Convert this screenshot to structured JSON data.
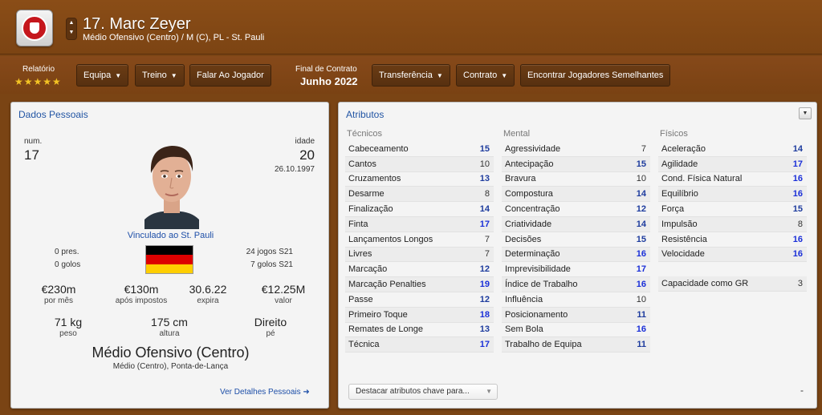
{
  "header": {
    "name": "17. Marc Zeyer",
    "subtitle": "Médio Ofensivo (Centro) / M (C), PL - St. Pauli",
    "arrow_up": "▲",
    "arrow_down": "▼"
  },
  "toolbar": {
    "rating_label": "Relatório",
    "rating_stars": "★★★★★",
    "rating_value": 5,
    "squad_btn": "Equipa",
    "training_btn": "Treino",
    "talk_btn": "Falar Ao Jogador",
    "contract_end_label": "Final de Contrato",
    "contract_end_value": "Junho 2022",
    "transfer_btn": "Transferência",
    "contract_btn": "Contrato",
    "similar_btn": "Encontrar Jogadores Semelhantes",
    "caret": "▼"
  },
  "personal": {
    "title": "Dados Pessoais",
    "num_label": "num.",
    "num_value": "17",
    "age_label": "idade",
    "age_value": "20",
    "dob": "26.10.1997",
    "linked": "Vinculado ao St. Pauli",
    "caps": "0 pres.",
    "goals_intl": "0 golos",
    "games": "24 jogos S21",
    "goals": "7 golos S21",
    "wage": "€230m",
    "wage_label": "por mês",
    "net": "€130m",
    "net_label": "após impostos",
    "expires": "30.6.22",
    "expires_label": "expira",
    "value": "€12.25M",
    "value_label": "valor",
    "weight": "71 kg",
    "weight_label": "peso",
    "height": "175 cm",
    "height_label": "altura",
    "foot": "Direito",
    "foot_label": "pé",
    "position": "Médio Ofensivo (Centro)",
    "position_sub": "Médio (Centro), Ponta-de-Lança",
    "details_link": "Ver Detalhes Pessoais ➜",
    "flag_colors": [
      "#000000",
      "#dd0000",
      "#ffce00"
    ]
  },
  "attributes": {
    "title": "Atributos",
    "collapse": "▼",
    "technical_head": "Técnicos",
    "mental_head": "Mental",
    "physical_head": "Físicos",
    "technical": [
      {
        "name": "Cabeceamento",
        "value": "15"
      },
      {
        "name": "Cantos",
        "value": "10"
      },
      {
        "name": "Cruzamentos",
        "value": "13"
      },
      {
        "name": "Desarme",
        "value": "8"
      },
      {
        "name": "Finalização",
        "value": "14"
      },
      {
        "name": "Finta",
        "value": "17"
      },
      {
        "name": "Lançamentos Longos",
        "value": "7"
      },
      {
        "name": "Livres",
        "value": "7"
      },
      {
        "name": "Marcação",
        "value": "12"
      },
      {
        "name": "Marcação Penalties",
        "value": "19"
      },
      {
        "name": "Passe",
        "value": "12"
      },
      {
        "name": "Primeiro Toque",
        "value": "18"
      },
      {
        "name": "Remates de Longe",
        "value": "13"
      },
      {
        "name": "Técnica",
        "value": "17"
      }
    ],
    "mental": [
      {
        "name": "Agressividade",
        "value": "7"
      },
      {
        "name": "Antecipação",
        "value": "15"
      },
      {
        "name": "Bravura",
        "value": "10"
      },
      {
        "name": "Compostura",
        "value": "14"
      },
      {
        "name": "Concentração",
        "value": "12"
      },
      {
        "name": "Criatividade",
        "value": "14"
      },
      {
        "name": "Decisões",
        "value": "15"
      },
      {
        "name": "Determinação",
        "value": "16"
      },
      {
        "name": "Imprevisibilidade",
        "value": "17"
      },
      {
        "name": "Índice de Trabalho",
        "value": "16"
      },
      {
        "name": "Influência",
        "value": "10"
      },
      {
        "name": "Posicionamento",
        "value": "11"
      },
      {
        "name": "Sem Bola",
        "value": "16"
      },
      {
        "name": "Trabalho de Equipa",
        "value": "11"
      }
    ],
    "physical": [
      {
        "name": "Aceleração",
        "value": "14"
      },
      {
        "name": "Agilidade",
        "value": "17"
      },
      {
        "name": "Cond. Física Natural",
        "value": "16"
      },
      {
        "name": "Equilíbrio",
        "value": "16"
      },
      {
        "name": "Força",
        "value": "15"
      },
      {
        "name": "Impulsão",
        "value": "8"
      },
      {
        "name": "Resistência",
        "value": "16"
      },
      {
        "name": "Velocidade",
        "value": "16"
      }
    ],
    "gk_label": "Capacidade como GR",
    "gk_value": "3",
    "highlight_select": "Destacar atributos chave para...",
    "minus": "-"
  }
}
